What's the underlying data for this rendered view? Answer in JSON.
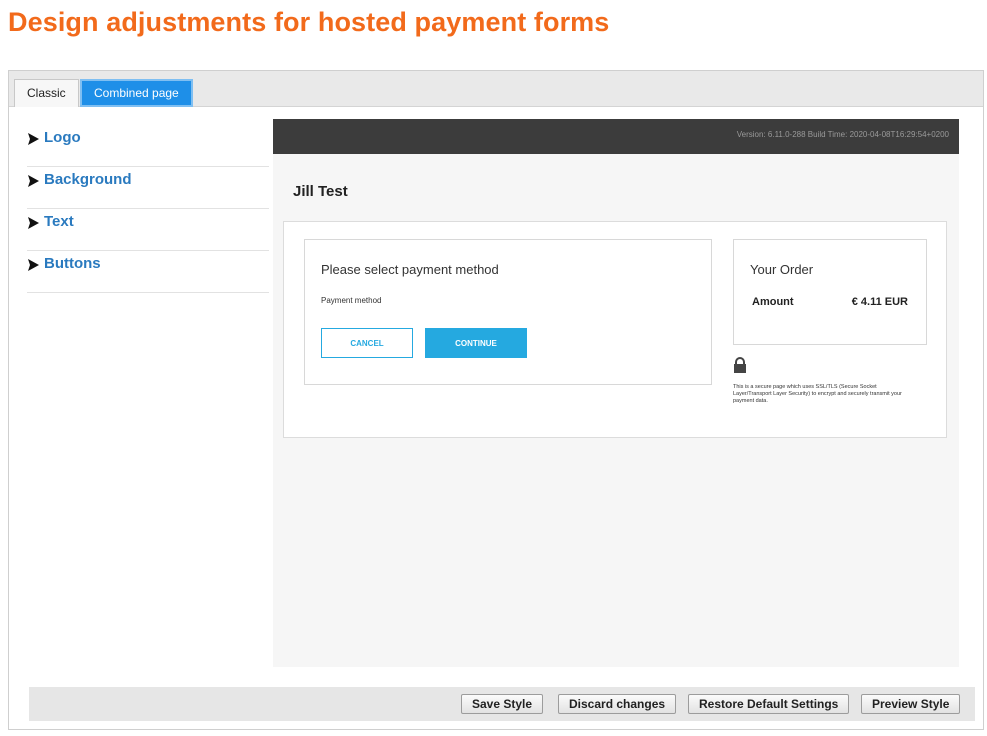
{
  "page": {
    "title": "Design adjustments for hosted payment forms"
  },
  "colors": {
    "title": "#f26a1b",
    "link": "#2a7abf",
    "active_tab": "#1e8fe8",
    "button_accent": "#25a9e0",
    "preview_header": "#3c3c3c"
  },
  "tabs": [
    {
      "label": "Classic",
      "active": false
    },
    {
      "label": "Combined page",
      "active": true
    }
  ],
  "sidebar": {
    "items": [
      {
        "label": "Logo",
        "icon": "arrow-right-icon"
      },
      {
        "label": "Background",
        "icon": "arrow-right-icon"
      },
      {
        "label": "Text",
        "icon": "arrow-right-icon"
      },
      {
        "label": "Buttons",
        "icon": "arrow-right-icon"
      }
    ]
  },
  "preview": {
    "version_text": "Version: 6.11.0-288 Build Time: 2020-04-08T16:29:54+0200",
    "merchant_name": "Jill Test",
    "method_title": "Please select payment method",
    "method_label": "Payment method",
    "cancel_label": "CANCEL",
    "continue_label": "CONTINUE",
    "order_title": "Your Order",
    "amount_label": "Amount",
    "amount_value": "€ 4.11 EUR",
    "lock_icon": "lock-icon",
    "secure_text": "This is a secure page which uses SSL/TLS (Secure Socket Layer/Transport Layer Security) to encrypt and securely transmit your payment data."
  },
  "footer": {
    "save_style": "Save Style",
    "discard_changes": "Discard changes",
    "restore_defaults": "Restore Default Settings",
    "preview_style": "Preview Style"
  }
}
